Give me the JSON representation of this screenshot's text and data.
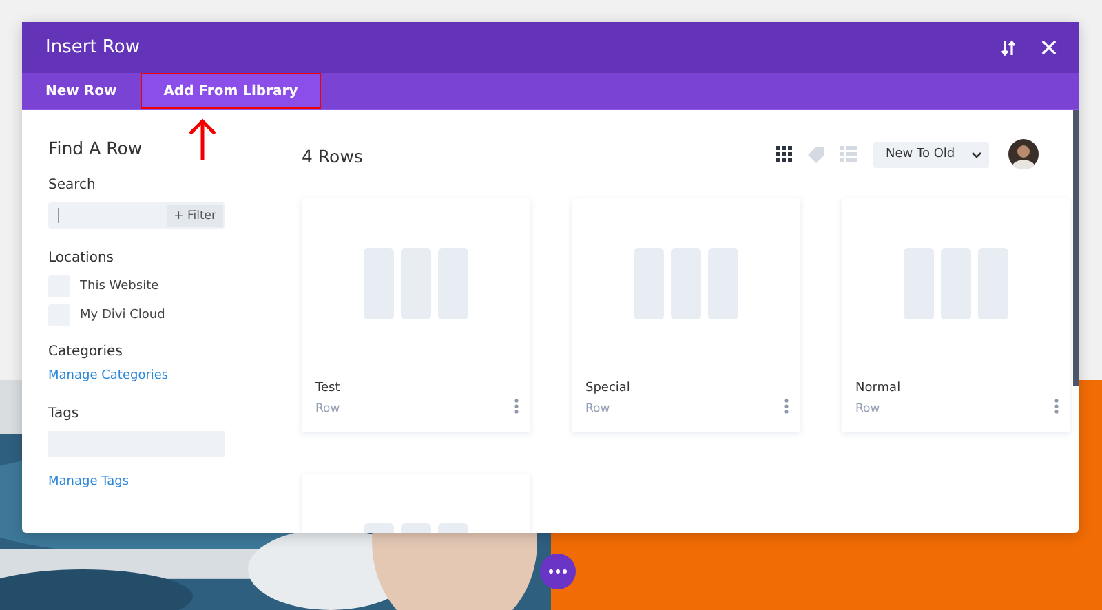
{
  "window": {
    "title": "Insert Row"
  },
  "tabs": [
    {
      "label": "New Row",
      "selected": false,
      "highlighted": false
    },
    {
      "label": "Add From Library",
      "selected": true,
      "highlighted": true
    }
  ],
  "sidebar": {
    "title": "Find A Row",
    "search": {
      "label": "Search",
      "filter": "+ Filter"
    },
    "locations": {
      "label": "Locations",
      "items": [
        {
          "label": "This Website",
          "checked": false
        },
        {
          "label": "My Divi Cloud",
          "checked": false
        }
      ]
    },
    "categories": {
      "label": "Categories",
      "link": "Manage Categories"
    },
    "tags": {
      "label": "Tags",
      "link": "Manage Tags"
    }
  },
  "content": {
    "count": "4 Rows",
    "sort": "New To Old",
    "views": [
      {
        "kind": "grid",
        "selected": true
      },
      {
        "kind": "tags",
        "selected": false
      },
      {
        "kind": "list",
        "selected": false
      }
    ],
    "cards": [
      {
        "kind": "full",
        "name": "Test",
        "type": "Row"
      },
      {
        "kind": "full",
        "name": "Special",
        "type": "Row"
      },
      {
        "kind": "full",
        "name": "Normal",
        "type": "Row"
      },
      {
        "kind": "cut_off"
      }
    ]
  }
}
